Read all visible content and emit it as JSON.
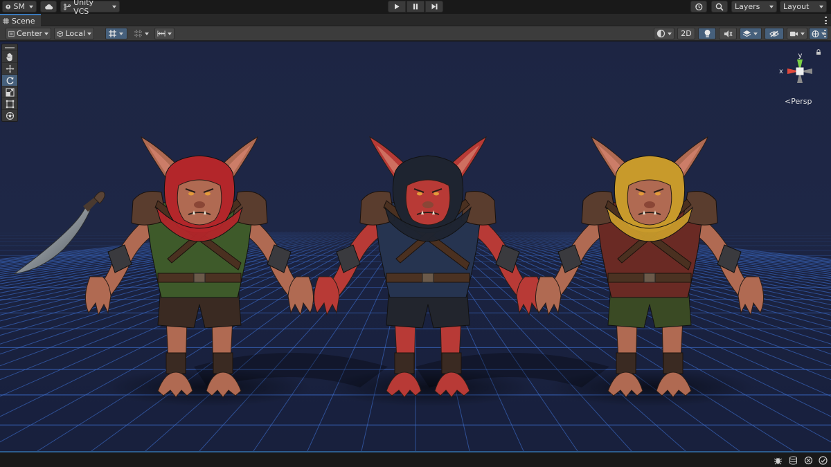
{
  "topbar": {
    "account_label": "SM",
    "vcs_label": "Unity VCS",
    "layers_label": "Layers",
    "layout_label": "Layout",
    "icons": [
      "account-icon",
      "cloud-icon",
      "vcs-branch-icon",
      "play-icon",
      "pause-icon",
      "step-icon",
      "history-icon",
      "search-icon"
    ]
  },
  "tabs": {
    "scene_label": "Scene"
  },
  "scene_toolbar": {
    "pivot_label": "Center",
    "space_label": "Local",
    "mode_2d_label": "2D",
    "icons": [
      "grid-snap-icon",
      "grid-icon",
      "incremental-snap-icon",
      "draw-mode-icon",
      "lighting-icon",
      "audio-icon",
      "effects-icon",
      "visibility-icon",
      "camera-icon",
      "gizmos-icon",
      "more-icon"
    ]
  },
  "viewport": {
    "camera_mode": "Persp",
    "gizmo": {
      "y_label": "y",
      "x_label": "x"
    },
    "objects": [
      "curved-dagger",
      "goblin-red-hood",
      "goblin-dark-hood",
      "goblin-yellow-hood"
    ],
    "colors": {
      "background": "#1e2746",
      "grid": "#3d6fd0",
      "hood_red": "#b3262a",
      "hood_dark": "#1e2430",
      "hood_yellow": "#c89a2b",
      "skin_tan": "#b06a52",
      "skin_red": "#b83a36"
    }
  },
  "tools": [
    "hand-tool",
    "move-tool",
    "rotate-tool",
    "scale-tool",
    "rect-tool",
    "transform-tool"
  ],
  "statusbar": {
    "icons": [
      "bug-icon",
      "cache-icon",
      "autogenerate-icon",
      "check-icon"
    ]
  }
}
